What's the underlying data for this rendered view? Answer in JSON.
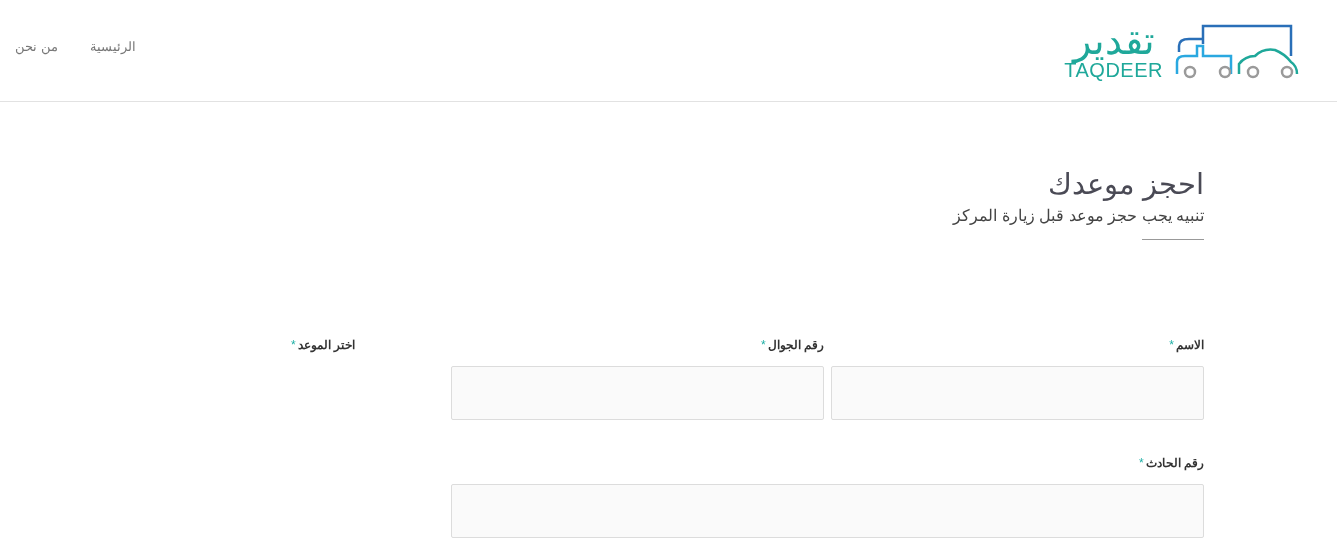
{
  "header": {
    "logo": {
      "arabic": "تقدير",
      "latin": "TAQDEER"
    },
    "nav": [
      {
        "label": "الرئيسية"
      },
      {
        "label": "من نحن"
      }
    ]
  },
  "page": {
    "title": "احجز موعدك",
    "notice": "تنبيه يجب حجز موعد قبل زيارة المركز"
  },
  "form": {
    "rows": [
      [
        {
          "label": "الاسم",
          "mark": "*",
          "kind": "input"
        },
        {
          "label": "رقم الجوال",
          "mark": "*",
          "kind": "input"
        }
      ],
      [
        {
          "label": "رقم الحادث",
          "mark": "*",
          "kind": "wide"
        }
      ]
    ],
    "side": {
      "label": "اختر الموعد",
      "mark": "*"
    }
  }
}
